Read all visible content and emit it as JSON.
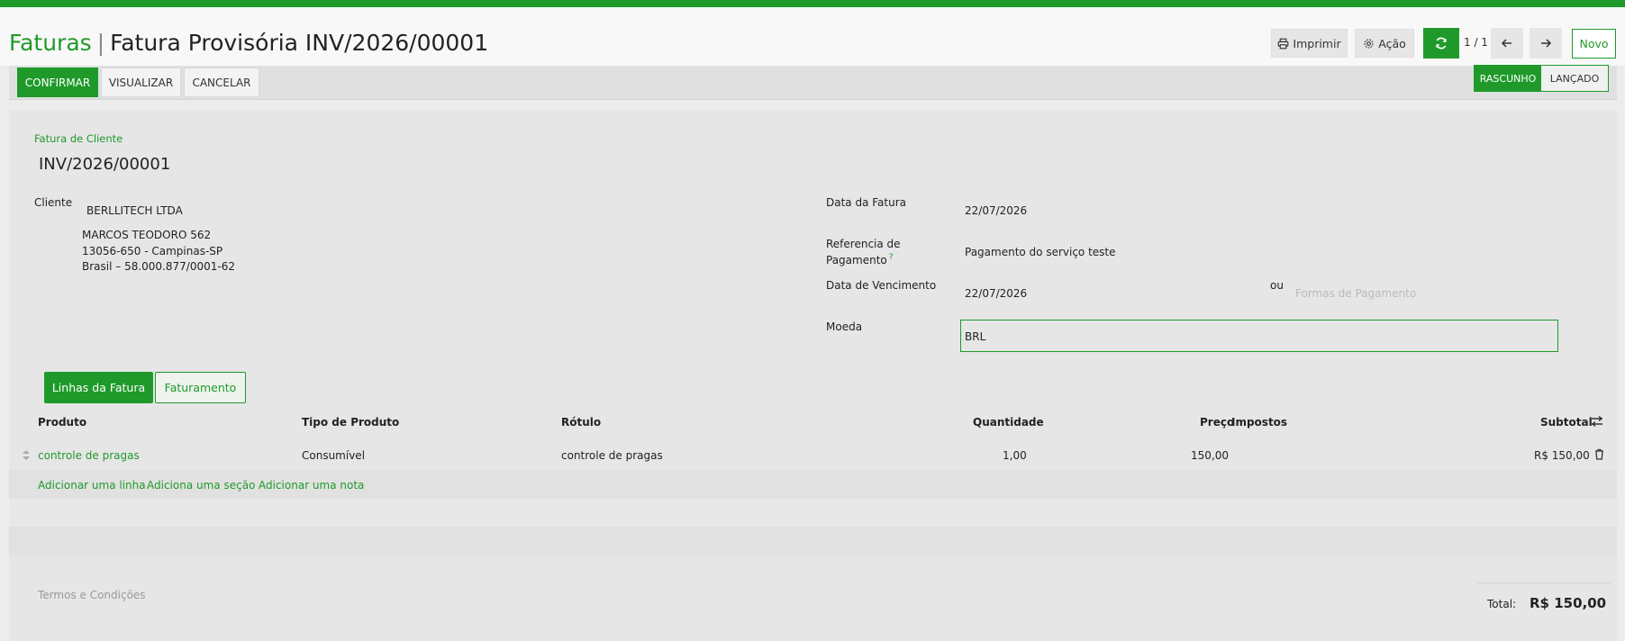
{
  "header": {
    "breadcrumb_root": "Faturas",
    "title": "Fatura Provisória INV/2026/00001",
    "print_label": "Imprimir",
    "action_label": "Ação",
    "pager": "1 / 1",
    "new_label": "Novo"
  },
  "statusbar": {
    "buttons": [
      "CONFIRMAR",
      "VISUALIZAR",
      "CANCELAR"
    ],
    "stages": [
      "RASCUNHO",
      "LANÇADO"
    ],
    "active_stage": "RASCUNHO"
  },
  "form": {
    "doc_type": "Fatura de Cliente",
    "number": "INV/2026/00001",
    "customer_label": "Cliente",
    "customer_name": "BERLLITECH LTDA",
    "address_line1": "MARCOS TEODORO 562",
    "address_line2": "13056-650 - Campinas-SP",
    "address_line3": "Brasil – 58.000.877/0001-62",
    "invoice_date_label": "Data da Fatura",
    "invoice_date": "22/07/2026",
    "payment_ref_label_1": "Referencia de",
    "payment_ref_label_2": "Pagamento",
    "payment_ref_help": "?",
    "payment_ref": "Pagamento do serviço teste",
    "due_date_label": "Data de Vencimento",
    "due_date": "22/07/2026",
    "or_label": "ou",
    "payment_terms_placeholder": "Formas de Pagamento",
    "currency_label": "Moeda",
    "currency": "BRL"
  },
  "tabs": [
    "Linhas da Fatura",
    "Faturamento"
  ],
  "lines": {
    "headers": [
      "Produto",
      "Tipo de Produto",
      "Rótulo",
      "Quantidade",
      "Preço",
      "Impostos",
      "Subtotal"
    ],
    "rows": [
      {
        "product": "controle de pragas",
        "product_type": "Consumível",
        "label": "controle de pragas",
        "quantity": "1,00",
        "price": "150,00",
        "taxes": "",
        "subtotal": "R$ 150,00"
      }
    ],
    "add_line": "Adicionar uma linha",
    "add_section": "Adiciona uma seção",
    "add_note": "Adicionar uma nota"
  },
  "footer": {
    "terms_placeholder": "Termos e Condições",
    "total_label": "Total:",
    "total_value": "R$ 150,00"
  }
}
